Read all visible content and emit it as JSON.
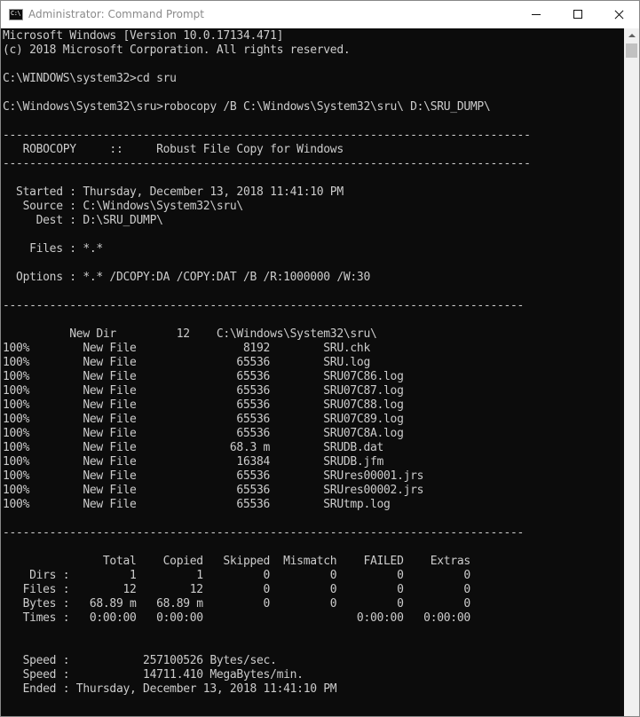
{
  "window": {
    "title": "Administrator: Command Prompt",
    "icon_label": "C:\\",
    "icons": {
      "app": "command-prompt-icon",
      "minimize": "minimize-icon",
      "maximize": "maximize-icon",
      "close": "close-icon"
    }
  },
  "console": {
    "lines": [
      "Microsoft Windows [Version 10.0.17134.471]",
      "(c) 2018 Microsoft Corporation. All rights reserved.",
      "",
      "C:\\WINDOWS\\system32>cd sru",
      "",
      "C:\\Windows\\System32\\sru>robocopy /B C:\\Windows\\System32\\sru\\ D:\\SRU_DUMP\\",
      "",
      "-------------------------------------------------------------------------------",
      "   ROBOCOPY     ::     Robust File Copy for Windows",
      "-------------------------------------------------------------------------------",
      "",
      "  Started : Thursday, December 13, 2018 11:41:10 PM",
      "   Source : C:\\Windows\\System32\\sru\\",
      "     Dest : D:\\SRU_DUMP\\",
      "",
      "    Files : *.*",
      "",
      "  Options : *.* /DCOPY:DA /COPY:DAT /B /R:1000000 /W:30",
      "",
      "------------------------------------------------------------------------------",
      "",
      "          New Dir         12    C:\\Windows\\System32\\sru\\",
      "100%        New File                8192        SRU.chk",
      "100%        New File               65536        SRU.log",
      "100%        New File               65536        SRU07C86.log",
      "100%        New File               65536        SRU07C87.log",
      "100%        New File               65536        SRU07C88.log",
      "100%        New File               65536        SRU07C89.log",
      "100%        New File               65536        SRU07C8A.log",
      "100%        New File              68.3 m        SRUDB.dat",
      "100%        New File               16384        SRUDB.jfm",
      "100%        New File               65536        SRUres00001.jrs",
      "100%        New File               65536        SRUres00002.jrs",
      "100%        New File               65536        SRUtmp.log",
      "",
      "------------------------------------------------------------------------------",
      "",
      "               Total    Copied   Skipped  Mismatch    FAILED    Extras",
      "    Dirs :         1         1         0         0         0         0",
      "   Files :        12        12         0         0         0         0",
      "   Bytes :   68.89 m   68.89 m         0         0         0         0",
      "   Times :   0:00:00   0:00:00                       0:00:00   0:00:00",
      "",
      "",
      "   Speed :           257100526 Bytes/sec.",
      "   Speed :           14711.410 MegaBytes/min.",
      "   Ended : Thursday, December 13, 2018 11:41:10 PM"
    ]
  }
}
